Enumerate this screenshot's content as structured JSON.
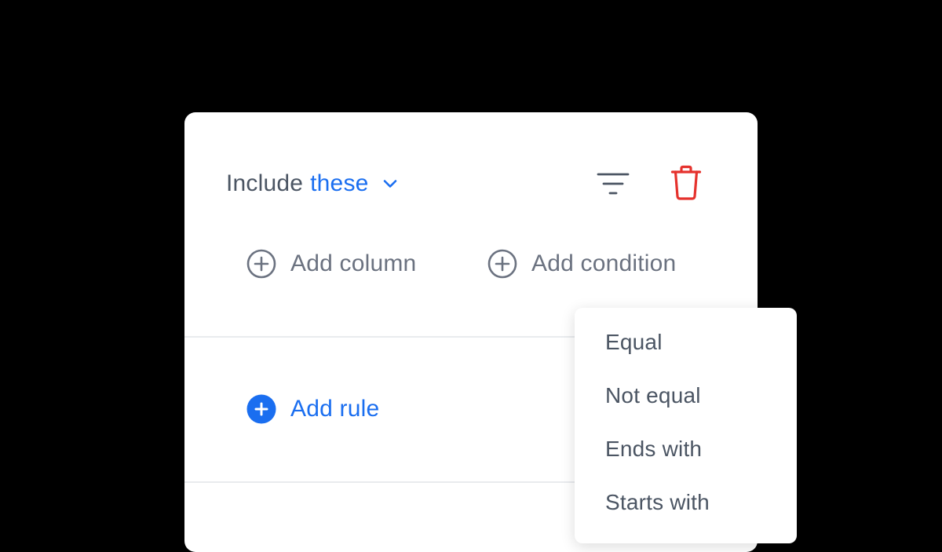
{
  "colors": {
    "accent": "#1a6ef0",
    "danger": "#e5322d",
    "text_muted": "#6b7280",
    "text_dark": "#4b5563",
    "divider": "#e9ebee",
    "backdrop": "#000000"
  },
  "rule_header": {
    "mode_prefix": "Include",
    "mode_value": "these",
    "mode_icon": "chevron-down-icon",
    "filter_icon": "filter-icon",
    "delete_icon": "trash-icon"
  },
  "actions": {
    "add_column": {
      "label": "Add column",
      "icon": "plus-circle-icon"
    },
    "add_condition": {
      "label": "Add condition",
      "icon": "plus-circle-icon"
    }
  },
  "add_rule": {
    "label": "Add rule",
    "icon": "plus-circle-filled-icon"
  },
  "condition_menu": {
    "items": [
      {
        "label": "Equal"
      },
      {
        "label": "Not equal"
      },
      {
        "label": "Ends with"
      },
      {
        "label": "Starts with"
      }
    ]
  }
}
